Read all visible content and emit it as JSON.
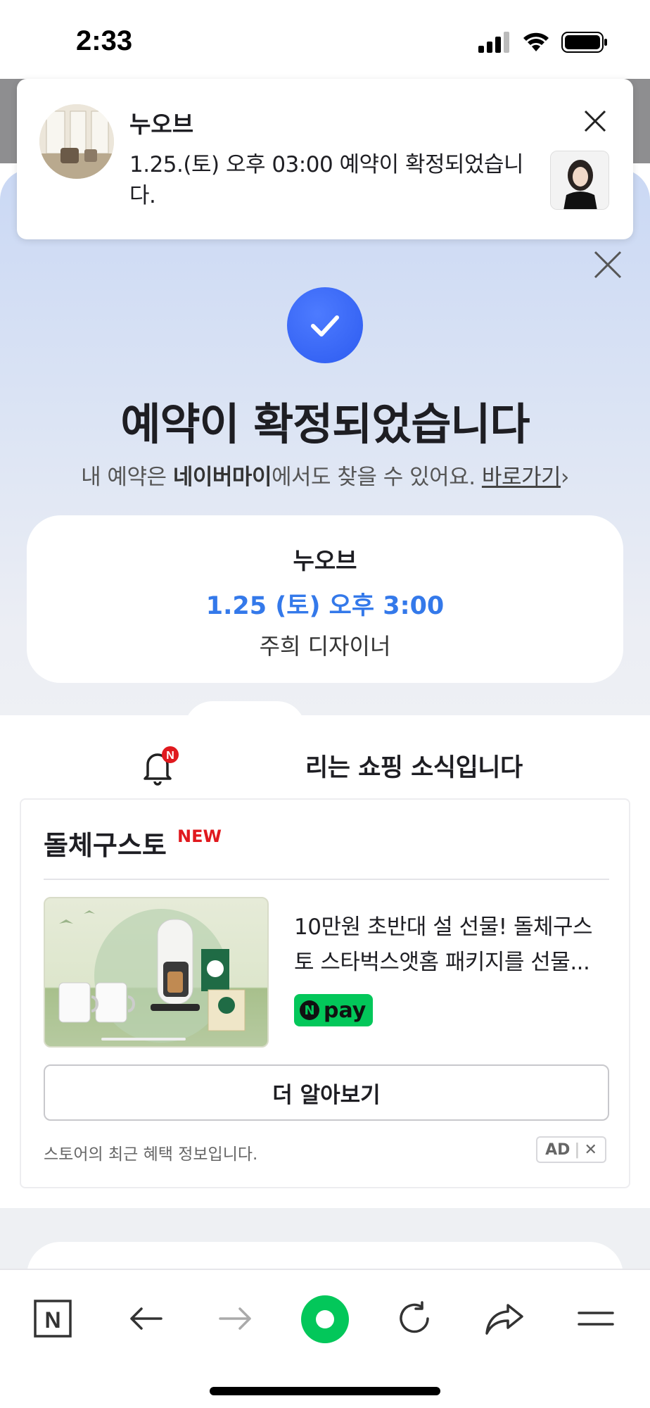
{
  "status_bar": {
    "time": "2:33"
  },
  "notification": {
    "title": "누오브",
    "body": "1.25.(토) 오후 03:00 예약이 확정되었습니다."
  },
  "confirmation": {
    "title": "예약이 확정되었습니다",
    "subtitle_prefix": "내 예약은 ",
    "subtitle_bold": "네이버마이",
    "subtitle_suffix": "에서도 찾을 수 있어요. ",
    "subtitle_link": "바로가기",
    "subtitle_link_arrow": "›"
  },
  "booking": {
    "shop": "누오브",
    "datetime": "1.25 (토) 오후 3:00",
    "designer": "주희 디자이너"
  },
  "shopping": {
    "bell_badge": "N",
    "header_text": "리는 쇼핑 소식입니다"
  },
  "ad": {
    "store_name": "돌체구스토",
    "new_badge": "NEW",
    "product_line1": "10만원 초반대 설 선물! 돌체구스",
    "product_line2": "토 스타벅스앳홈 패키지를 선물...",
    "npay_n": "N",
    "npay_label": "pay",
    "more_button": "더 알아보기",
    "footer_text": "스토어의 최근 혜택 정보입니다.",
    "ad_label": "AD",
    "ad_close": "✕"
  },
  "toolbar": {
    "naver_label": "N",
    "items": [
      "naver-home",
      "back",
      "forward",
      "green-dot",
      "reload",
      "share",
      "menu"
    ]
  },
  "colors": {
    "accent_blue": "#3479ea",
    "check_blue": "#2d5bf0",
    "naver_green": "#03c75a",
    "new_red": "#e0191e"
  }
}
